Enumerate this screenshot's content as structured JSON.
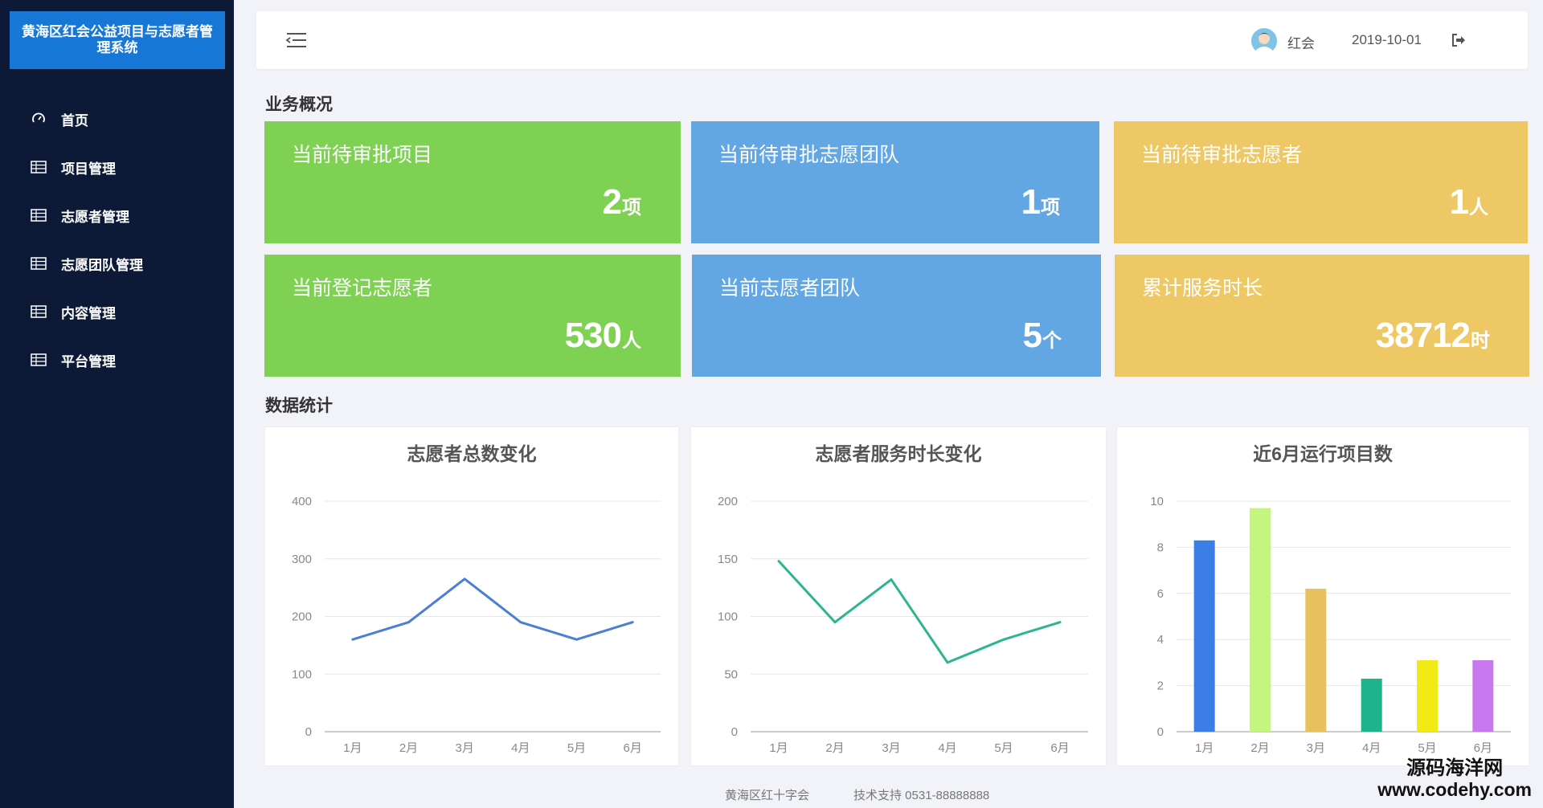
{
  "app": {
    "title": "黄海区红会公益项目与志愿者管理系统"
  },
  "sidebar": {
    "items": [
      {
        "label": "首页",
        "icon": "dashboard-icon"
      },
      {
        "label": "项目管理",
        "icon": "table-icon"
      },
      {
        "label": "志愿者管理",
        "icon": "table-icon"
      },
      {
        "label": "志愿团队管理",
        "icon": "table-icon"
      },
      {
        "label": "内容管理",
        "icon": "table-icon"
      },
      {
        "label": "平台管理",
        "icon": "table-icon"
      }
    ]
  },
  "header": {
    "user": "红会",
    "date": "2019-10-01"
  },
  "overview": {
    "title": "业务概况",
    "cards": [
      {
        "label": "当前待审批项目",
        "value": "2",
        "unit": "项",
        "color": "#7ed153"
      },
      {
        "label": "当前待审批志愿团队",
        "value": "1",
        "unit": "项",
        "color": "#62a6e4"
      },
      {
        "label": "当前待审批志愿者",
        "value": "1",
        "unit": "人",
        "color": "#edc864"
      },
      {
        "label": "当前登记志愿者",
        "value": "530",
        "unit": "人",
        "color": "#7ed153"
      },
      {
        "label": "当前志愿者团队",
        "value": "5",
        "unit": "个",
        "color": "#62a6e4"
      },
      {
        "label": "累计服务时长",
        "value": "38712",
        "unit": "时",
        "color": "#edc864"
      }
    ]
  },
  "stats": {
    "title": "数据统计"
  },
  "chart_data": [
    {
      "type": "line",
      "title": "志愿者总数变化",
      "categories": [
        "1月",
        "2月",
        "3月",
        "4月",
        "5月",
        "6月"
      ],
      "series": [
        {
          "values": [
            160,
            190,
            265,
            190,
            160,
            190
          ],
          "color": "#4a7fd1"
        }
      ],
      "ylim": [
        0,
        400
      ],
      "yticks": [
        0,
        100,
        200,
        300,
        400
      ],
      "grid": true
    },
    {
      "type": "line",
      "title": "志愿者服务时长变化",
      "categories": [
        "1月",
        "2月",
        "3月",
        "4月",
        "5月",
        "6月"
      ],
      "series": [
        {
          "values": [
            148,
            95,
            132,
            60,
            80,
            95
          ],
          "color": "#2db592"
        }
      ],
      "ylim": [
        0,
        200
      ],
      "yticks": [
        0,
        50,
        100,
        150,
        200
      ],
      "grid": true
    },
    {
      "type": "bar",
      "title": "近6月运行项目数",
      "categories": [
        "1月",
        "2月",
        "3月",
        "4月",
        "5月",
        "6月"
      ],
      "values": [
        8.3,
        9.7,
        6.2,
        2.3,
        3.1,
        3.1
      ],
      "colors": [
        "#3a7ee6",
        "#c4f57f",
        "#e8c05e",
        "#1fb38c",
        "#f2ea17",
        "#c878ee"
      ],
      "ylim": [
        0,
        10
      ],
      "yticks": [
        0,
        2,
        4,
        6,
        8,
        10
      ],
      "grid": true
    }
  ],
  "footer": {
    "org": "黄海区红十字会",
    "support": "技术支持 0531-88888888"
  },
  "watermark": {
    "line1": "源码海洋网",
    "line2": "www.codehy.com"
  }
}
